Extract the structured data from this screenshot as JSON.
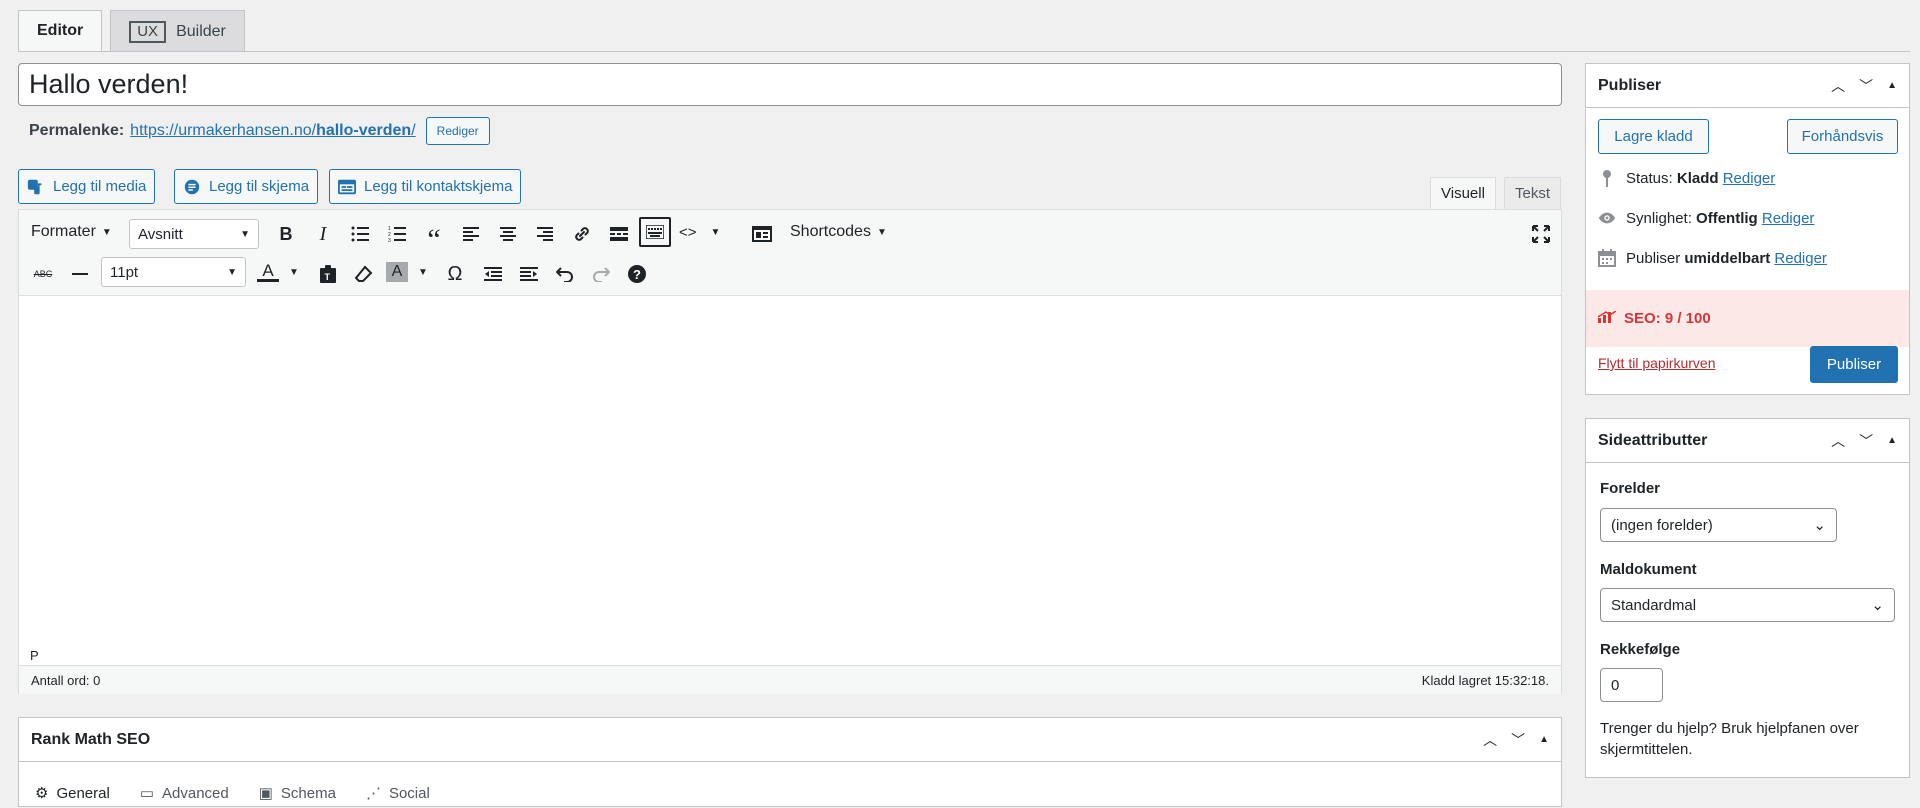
{
  "tabs": {
    "editor": "Editor",
    "ux_badge": "UX",
    "builder": "Builder"
  },
  "post": {
    "title": "Hallo verden!",
    "permalink_label": "Permalenke:",
    "permalink_base": "https://urmakerhansen.no/",
    "permalink_slug": "hallo-verden",
    "permalink_tail": "/",
    "permalink_edit": "Rediger"
  },
  "media_buttons": {
    "add_media": "Legg til media",
    "add_form": "Legg til skjema",
    "add_contact_form": "Legg til kontaktskjema"
  },
  "editor_tabs": {
    "visual": "Visuell",
    "text": "Tekst"
  },
  "toolbar": {
    "formats": "Formater",
    "paragraph": "Avsnitt",
    "shortcodes": "Shortcodes",
    "font_size": "11pt"
  },
  "editor": {
    "path": "P",
    "word_count": "Antall ord: 0",
    "saved": "Kladd lagret 15:32:18."
  },
  "rank_math": {
    "title": "Rank Math SEO",
    "tabs": [
      "General",
      "Advanced",
      "Schema",
      "Social"
    ]
  },
  "publish": {
    "title": "Publiser",
    "save_draft": "Lagre kladd",
    "preview": "Forhåndsvis",
    "status_label": "Status:",
    "status_value": "Kladd",
    "visibility_label": "Synlighet:",
    "visibility_value": "Offentlig",
    "publish_label": "Publiser",
    "publish_value": "umiddelbart",
    "edit": "Rediger",
    "seo": "SEO: 9 / 100",
    "trash": "Flytt til papirkurven",
    "publish_button": "Publiser"
  },
  "page_attributes": {
    "title": "Sideattributter",
    "parent_label": "Forelder",
    "parent_value": "(ingen forelder)",
    "template_label": "Maldokument",
    "template_value": "Standardmal",
    "order_label": "Rekkefølge",
    "order_value": "0",
    "help": "Trenger du hjelp? Bruk hjelpfanen over skjermtittelen."
  },
  "colors": {
    "accent": "#2271b1",
    "seo_bad": "#d63638",
    "seo_bg": "#fde8e8"
  }
}
